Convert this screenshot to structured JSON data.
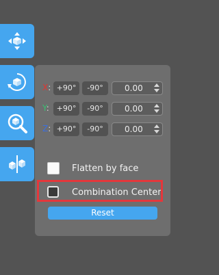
{
  "toolbar": {
    "tools": [
      {
        "name": "move-icon"
      },
      {
        "name": "rotate-icon"
      },
      {
        "name": "scale-icon"
      },
      {
        "name": "mirror-icon"
      }
    ],
    "accent": "#45a6ef"
  },
  "rotate_panel": {
    "axes": [
      {
        "label": "X",
        "color": "#e3342f",
        "plus": "+90°",
        "minus": "-90°",
        "value": "0.00"
      },
      {
        "label": "Y",
        "color": "#38c172",
        "plus": "+90°",
        "minus": "-90°",
        "value": "0.00"
      },
      {
        "label": "Z",
        "color": "#3b6fe0",
        "plus": "+90°",
        "minus": "-90°",
        "value": "0.00"
      }
    ],
    "colon": ":",
    "flatten_by_face": {
      "label": "Flatten by face",
      "checked": false
    },
    "combination_center": {
      "label": "Combination Center",
      "checked": false,
      "highlight_color": "#e5373b"
    },
    "reset_label": "Reset"
  }
}
